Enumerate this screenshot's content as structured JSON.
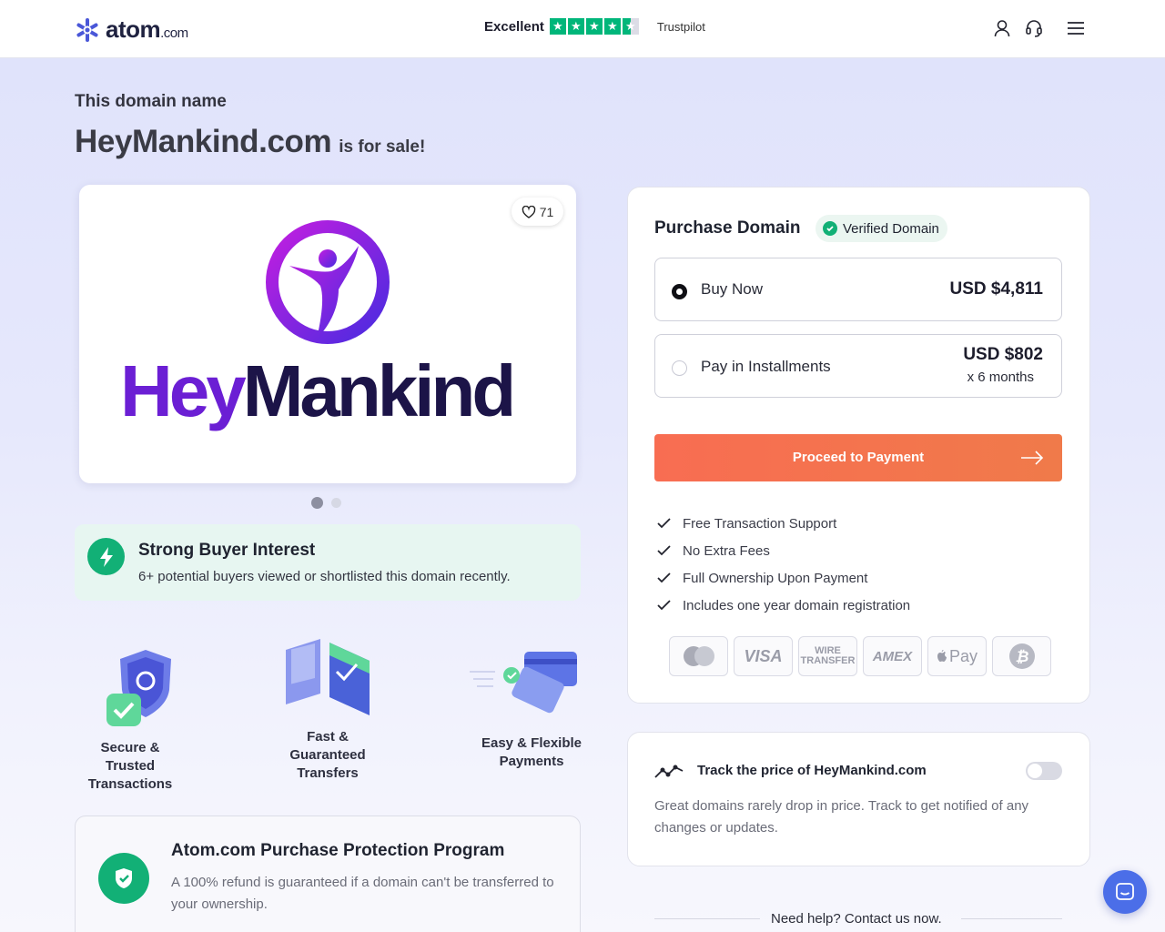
{
  "header": {
    "logo_text": "atom",
    "logo_suffix": ".com",
    "trust_rating": "Excellent",
    "trust_brand": "Trustpilot",
    "trust_stars": 4.5,
    "icons": [
      "user-icon",
      "headset-icon",
      "menu-icon"
    ]
  },
  "listing": {
    "eyebrow": "This domain name",
    "domain": "HeyMankind.com",
    "for_sale": "is for sale!",
    "likes": "71",
    "brand_word_a": "Hey",
    "brand_word_b": "Mankind",
    "carousel_pages": 2,
    "carousel_active": 1
  },
  "interest": {
    "title": "Strong Buyer Interest",
    "text": "6+ potential buyers viewed or shortlisted this domain recently."
  },
  "features": [
    {
      "line1": "Secure & Trusted",
      "line2": "Transactions"
    },
    {
      "line1": "Fast &",
      "line2": "Guaranteed",
      "line3": "Transfers"
    },
    {
      "line1": "Easy & Flexible",
      "line2": "Payments"
    }
  ],
  "protection": {
    "title": "Atom.com Purchase Protection Program",
    "text": "A 100% refund is guaranteed if a domain can't be transferred to your ownership."
  },
  "purchase": {
    "title": "Purchase Domain",
    "verified": "Verified Domain",
    "options": [
      {
        "label": "Buy Now",
        "price": "USD $4,811",
        "selected": true
      },
      {
        "label": "Pay in Installments",
        "price": "USD $802",
        "sub": "x 6 months",
        "selected": false
      }
    ],
    "cta": "Proceed to Payment",
    "benefits": [
      "Free Transaction Support",
      "No Extra Fees",
      "Full Ownership Upon Payment",
      "Includes one year domain registration"
    ],
    "payment_methods": [
      "mastercard",
      "VISA",
      "WIRE TRANSFER",
      "AMEX",
      "Pay",
      "bitcoin"
    ]
  },
  "track": {
    "title": "Track the price of HeyMankind.com",
    "text": "Great domains rarely drop in price. Track to get notified of any changes or updates.",
    "enabled": false
  },
  "help": "Need help? Contact us now.",
  "colors": {
    "accent_green": "#12b076",
    "cta_orange": "#f86d52",
    "brand_purple": "#6b1fd4",
    "chat_blue": "#4b6ee8"
  }
}
